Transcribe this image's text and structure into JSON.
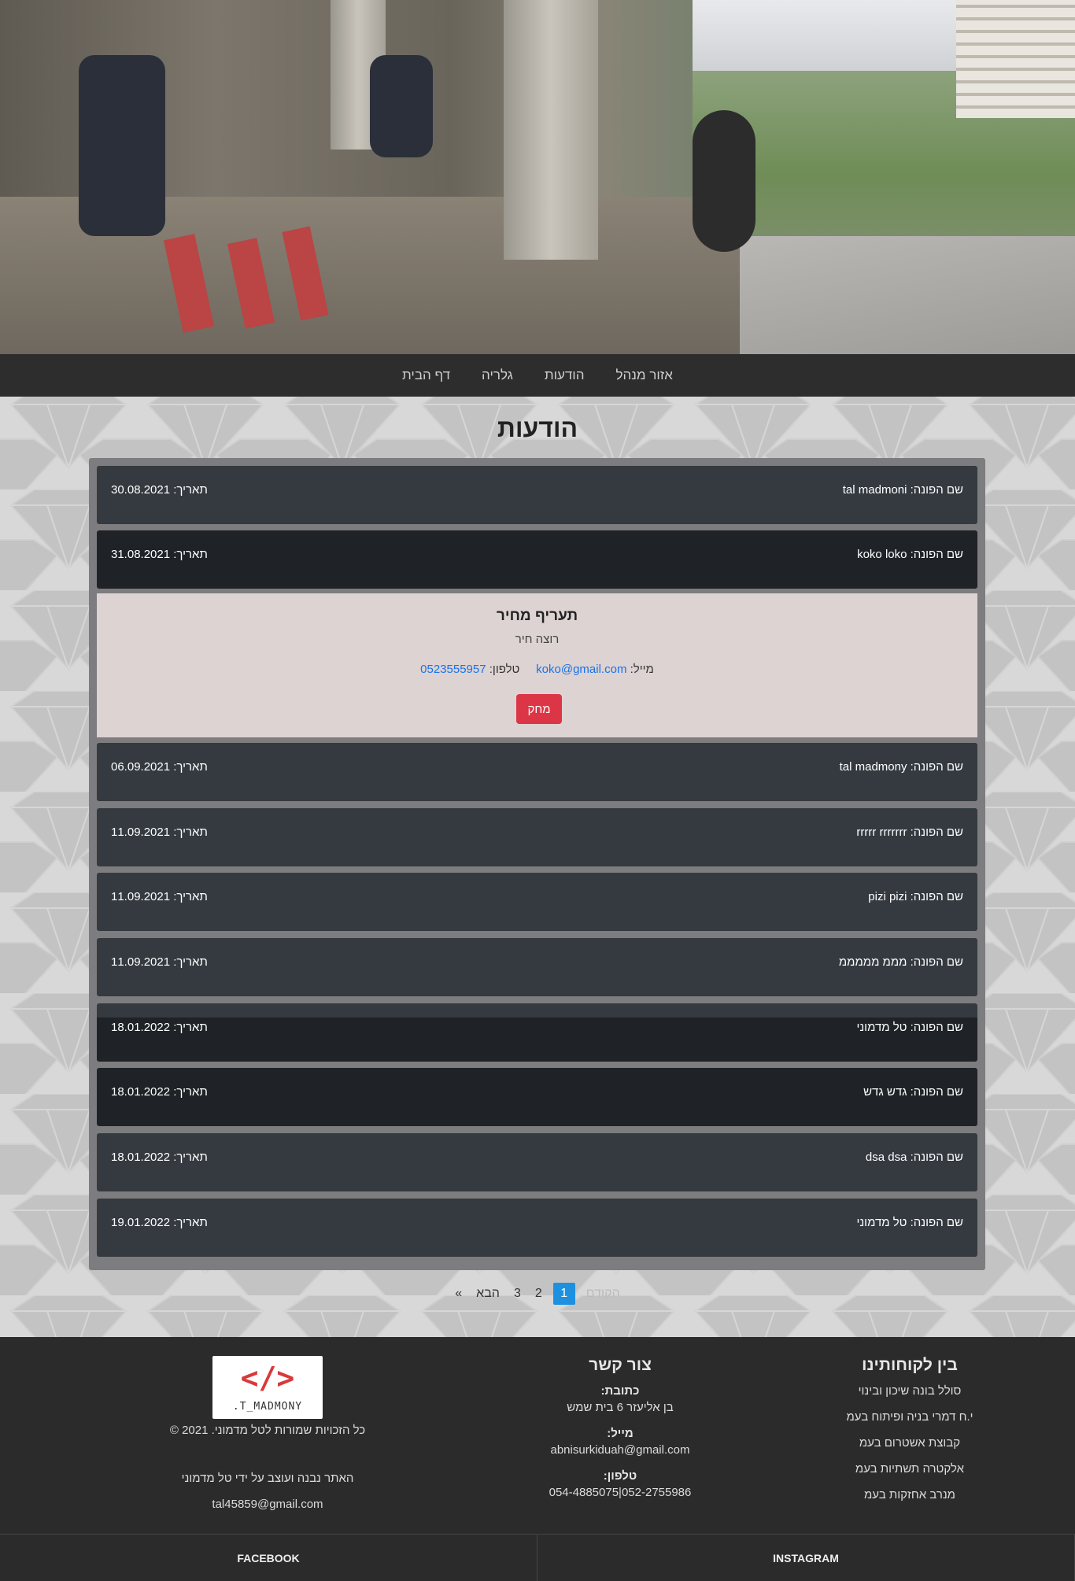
{
  "nav": {
    "home": "דף הבית",
    "gallery": "גלריה",
    "messages": "הודעות",
    "admin": "אזור מנהל"
  },
  "page_title": "הודעות",
  "messages": [
    {
      "name_label": "שם הפונה: tal madmoni",
      "date_label": "תאריך: 30.08.2021"
    },
    {
      "name_label": "שם הפונה: koko loko",
      "date_label": "תאריך: 31.08.2021"
    },
    {
      "name_label": "שם הפונה: tal madmony",
      "date_label": "תאריך: 06.09.2021"
    },
    {
      "name_label": "שם הפונה: rrrrr rrrrrrr",
      "date_label": "תאריך: 11.09.2021"
    },
    {
      "name_label": "שם הפונה: pizi pizi",
      "date_label": "תאריך: 11.09.2021"
    },
    {
      "name_label": "שם הפונה: מממ מממממ",
      "date_label": "תאריך: 11.09.2021"
    },
    {
      "name_label": "שם הפונה: טל מדמוני",
      "date_label": "תאריך: 18.01.2022"
    },
    {
      "name_label": "שם הפונה: גדש גדש",
      "date_label": "תאריך: 18.01.2022"
    },
    {
      "name_label": "שם הפונה: dsa dsa",
      "date_label": "תאריך: 18.01.2022"
    },
    {
      "name_label": "שם הפונה: טל מדמוני",
      "date_label": "תאריך: 19.01.2022"
    }
  ],
  "detail": {
    "subject": "תעריף מחיר",
    "body": "רוצה חיר",
    "email_label": "מייל:",
    "email": "koko@gmail.com",
    "phone_label": "טלפון:",
    "phone": "0523555957",
    "delete_label": "מחק"
  },
  "pager": {
    "prev": "הקודם",
    "current": "1",
    "p2": "2",
    "p3": "3",
    "next": "הבא",
    "last": "»"
  },
  "footer": {
    "clients_title": "בין לקוחותינו",
    "clients": [
      "סולל בונה שיכון ובינוי",
      "י.ח דמרי בניה ופיתוח בעמ",
      "קבוצת אשטרום בעמ",
      "אלקטרה תשתיות בעמ",
      "מנרב אחזקות בעמ"
    ],
    "contact_title": "צור קשר",
    "address_label": "כתובת:",
    "address": "בן אליעזר 6 בית שמש",
    "mail_label": "מייל:",
    "mail": "abnisurkiduah@gmail.com",
    "phone_label": "טלפון:",
    "phone": "052-2755986|054-4885075",
    "logo_code": "</>",
    "logo_brand": "T_MADMONY.",
    "copyright": "כל הזכויות שמורות לטל מדמוני.  2021  ©",
    "built_by": "האתר נבנה ועוצב על ידי טל מדמוני",
    "builder_mail": "tal45859@gmail.com"
  },
  "social": {
    "facebook": "FACEBOOK",
    "instagram": "INSTAGRAM"
  }
}
